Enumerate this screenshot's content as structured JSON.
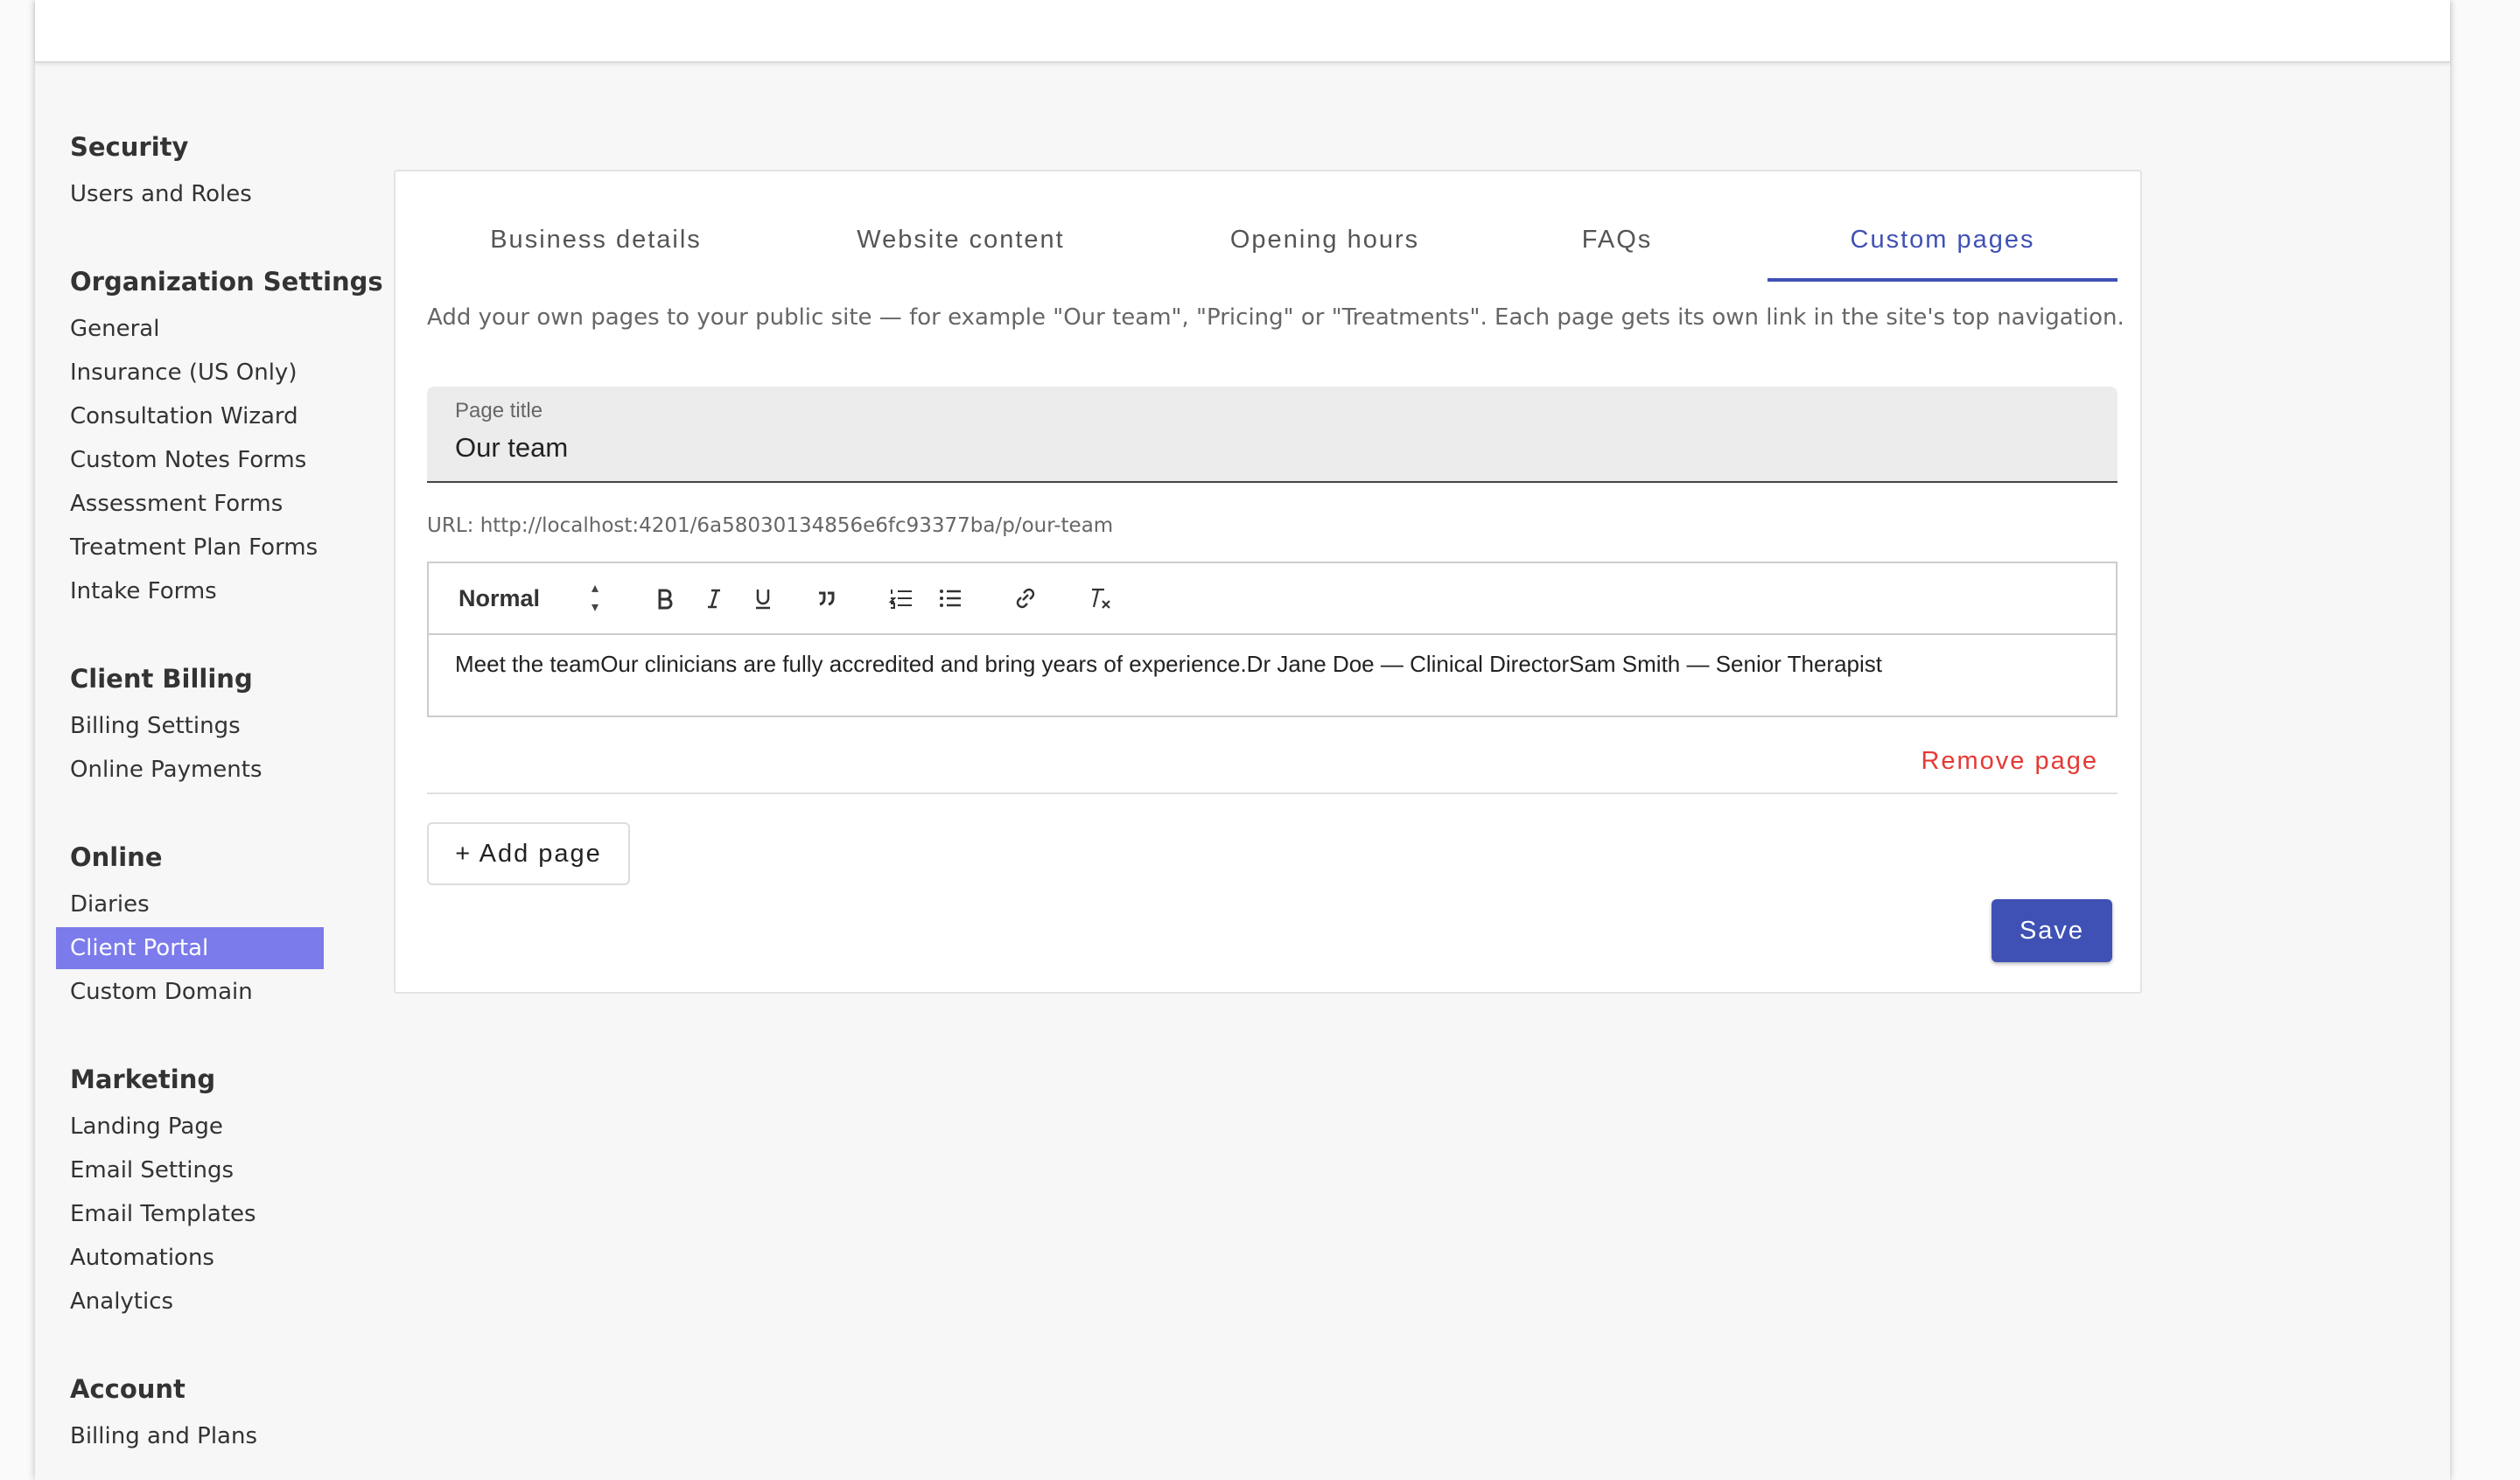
{
  "sidebar": {
    "groups": [
      {
        "heading": "Security",
        "items": [
          "Users and Roles"
        ]
      },
      {
        "heading": "Organization Settings",
        "items": [
          "General",
          "Insurance (US Only)",
          "Consultation Wizard",
          "Custom Notes Forms",
          "Assessment Forms",
          "Treatment Plan Forms",
          "Intake Forms"
        ]
      },
      {
        "heading": "Client Billing",
        "items": [
          "Billing Settings",
          "Online Payments"
        ]
      },
      {
        "heading": "Online",
        "items": [
          "Diaries",
          "Client Portal",
          "Custom Domain"
        ]
      },
      {
        "heading": "Marketing",
        "items": [
          "Landing Page",
          "Email Settings",
          "Email Templates",
          "Automations",
          "Analytics"
        ]
      },
      {
        "heading": "Account",
        "items": [
          "Billing and Plans"
        ]
      }
    ],
    "active_item": "Client Portal"
  },
  "tabs": [
    "Business details",
    "Website content",
    "Opening hours",
    "FAQs",
    "Custom pages"
  ],
  "active_tab": "Custom pages",
  "description": "Add your own pages to your public site — for example \"Our team\", \"Pricing\" or \"Treatments\". Each page gets its own link in the site's top navigation.",
  "page_title_field": {
    "label": "Page title",
    "value": "Our team"
  },
  "url_text": "URL: http://localhost:4201/6a58030134856e6fc93377ba/p/our-team",
  "editor": {
    "format_select": "Normal",
    "toolbar_icons": [
      "bold-icon",
      "italic-icon",
      "underline-icon",
      "blockquote-icon",
      "ordered-list-icon",
      "bullet-list-icon",
      "link-icon",
      "clear-format-icon"
    ],
    "content": "Meet the teamOur clinicians are fully accredited and bring years of experience.Dr Jane Doe — Clinical DirectorSam Smith — Senior Therapist"
  },
  "remove_page_label": "Remove page",
  "add_page_label": "+ Add page",
  "save_label": "Save",
  "colors": {
    "accent": "#3f51b5",
    "active_sidebar": "#7b7bec",
    "danger": "#e53935"
  }
}
